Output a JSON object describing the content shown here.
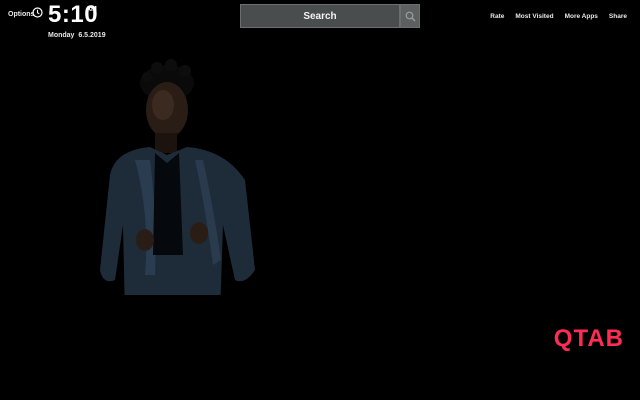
{
  "header": {
    "options_label": "Options",
    "time": "5:10",
    "ampm": "AM",
    "date": "Monday  6.5.2019"
  },
  "search": {
    "placeholder": "Search"
  },
  "nav": {
    "rate": "Rate",
    "most_visited": "Most Visited",
    "more_apps": "More Apps",
    "share": "Share"
  },
  "brand": {
    "logo": "QTAB",
    "color": "#ff2d55"
  },
  "icons": {
    "clock": "clock-icon",
    "search": "search-icon"
  },
  "colors": {
    "background": "#000000",
    "search_bg": "#4a4d4e"
  }
}
